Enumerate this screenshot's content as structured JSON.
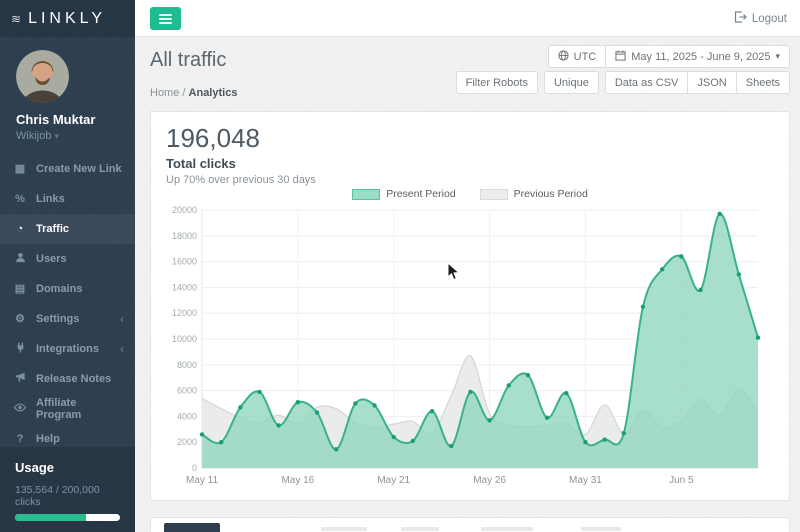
{
  "app": {
    "logout_label": "Logout"
  },
  "icons": {
    "wave": "≋",
    "grid": "▦",
    "percent": "%",
    "pie": "◔",
    "list": "▤",
    "gear": "⚙",
    "question": "?",
    "caret": "▾",
    "chevron": "‹"
  },
  "sidebar": {
    "logo": "LINKLY",
    "user": {
      "name": "Chris Muktar",
      "org": "Wikijob",
      "caret": "▾"
    },
    "items": [
      {
        "label": "Create New Link"
      },
      {
        "label": "Links"
      },
      {
        "label": "Traffic",
        "active": true
      },
      {
        "label": "Users"
      },
      {
        "label": "Domains"
      },
      {
        "label": "Settings",
        "chevron": "‹"
      },
      {
        "label": "Integrations",
        "chevron": "‹"
      },
      {
        "label": "Release Notes"
      },
      {
        "label": "Affiliate Program"
      },
      {
        "label": "Help"
      }
    ],
    "usage": {
      "title": "Usage",
      "text": "135,564 / 200,000 clicks",
      "percent": 68
    }
  },
  "header": {
    "title": "All traffic",
    "breadcrumb": {
      "home": "Home",
      "separator": "/",
      "current": "Analytics"
    }
  },
  "controls": {
    "utc_label": "UTC",
    "date_range": "May 11, 2025 - June 9, 2025",
    "date_caret": "▾",
    "buttons": [
      "Filter Robots",
      "Unique",
      "Data as CSV",
      "JSON",
      "Sheets"
    ]
  },
  "stats": {
    "total": "196,048",
    "label": "Total clicks",
    "subtitle": "Up 70% over previous 30 days"
  },
  "chart_data": {
    "type": "area",
    "title": "Total clicks",
    "xlabel": "",
    "ylabel": "",
    "ylim": [
      0,
      20000
    ],
    "y_tick_step": 2000,
    "num_points": 30,
    "x_start": "May 11",
    "x_end": "Jun 9",
    "x_tick_labels": [
      "May 11",
      "May 16",
      "May 21",
      "May 26",
      "May 31",
      "Jun 5"
    ],
    "x_tick_indices": [
      0,
      5,
      10,
      15,
      20,
      25
    ],
    "grid": true,
    "legend_position": "top-center",
    "legend": [
      {
        "name": "Present Period",
        "color": "#9adcc4"
      },
      {
        "name": "Previous Period",
        "color": "#ececec"
      }
    ],
    "series": [
      {
        "name": "Present Period",
        "line": "#3ab08d",
        "fill": "#8fd6bc",
        "fill_opacity": 0.78,
        "marker": "#199d7a",
        "values": [
          2600,
          2000,
          4700,
          5900,
          3300,
          5100,
          4300,
          1450,
          5000,
          4850,
          2400,
          2100,
          4400,
          1700,
          5900,
          3700,
          6400,
          7200,
          3900,
          5800,
          2000,
          2200,
          2700,
          12500,
          15400,
          16400,
          13800,
          19700,
          15000,
          10100
        ]
      },
      {
        "name": "Previous Period",
        "line": "#d2d6d3",
        "fill": "#e8eae8",
        "fill_opacity": 0.9,
        "marker": null,
        "values": [
          5400,
          4600,
          3900,
          3500,
          4100,
          3400,
          4700,
          4600,
          3500,
          3100,
          3400,
          3600,
          2700,
          5600,
          8700,
          4200,
          3300,
          3200,
          3300,
          3400,
          2600,
          4900,
          2700,
          4400,
          3100,
          3600,
          5300,
          4100,
          6100,
          4400
        ]
      }
    ]
  },
  "colors": {
    "accent_green": "#1fbc92",
    "sidebar_bg": "#2e3f50",
    "progress_fill": "#27bd8e"
  }
}
